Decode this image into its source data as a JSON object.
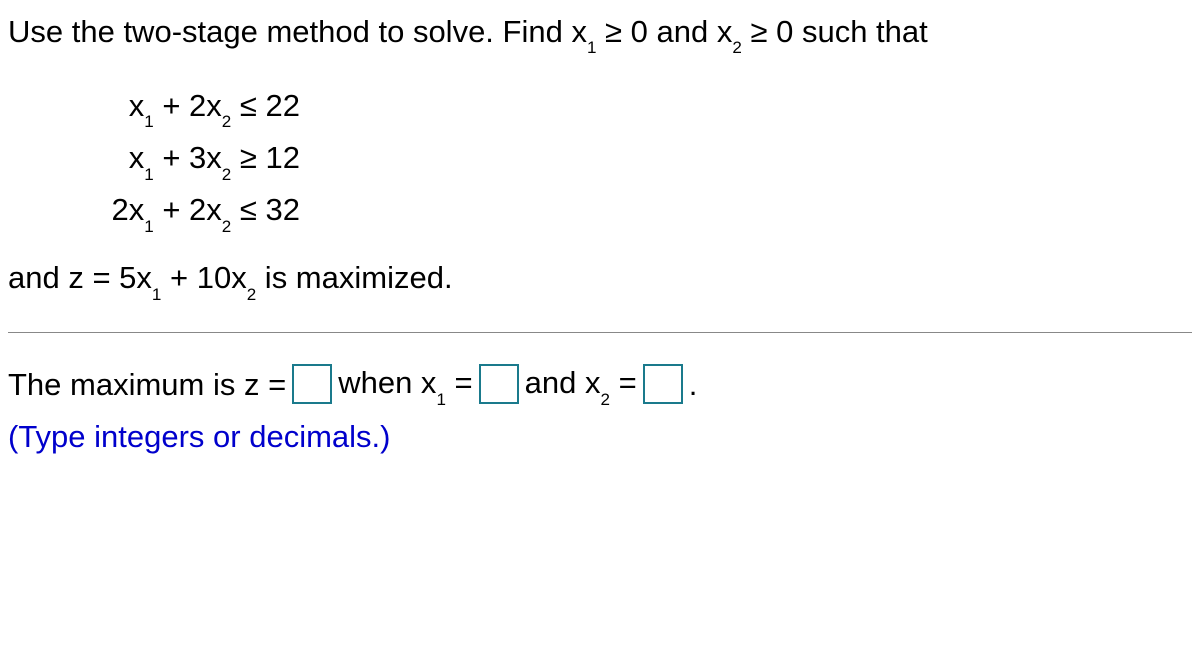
{
  "intro": {
    "part1": "Use the two-stage method to solve. Find ",
    "var1": "x",
    "s1": "1",
    "ge1": " ≥ 0 and ",
    "var2": "x",
    "s2": "2",
    "ge2": " ≥ 0 such that"
  },
  "constraints": {
    "c1": {
      "l": "x",
      "s1": "1",
      "p": " + 2x",
      "s2": "2",
      "op": " ≤ 22"
    },
    "c2": {
      "l": "x",
      "s1": "1",
      "p": " + 3x",
      "s2": "2",
      "op": " ≥ 12"
    },
    "c3": {
      "l": "2x",
      "s1": "1",
      "p": " + 2x",
      "s2": "2",
      "op": " ≤ 32"
    }
  },
  "objective": {
    "pre": "and z = 5x",
    "s1": "1",
    "mid": " + 10x",
    "s2": "2",
    "post": " is maximized."
  },
  "answer": {
    "t1": "The maximum is z = ",
    "t2": " when x",
    "s1": "1",
    "t3": " = ",
    "t4": " and x",
    "s2": "2",
    "t5": " = ",
    "period": "."
  },
  "note": "(Type integers or decimals.)",
  "inputs": {
    "z": "",
    "x1": "",
    "x2": ""
  }
}
